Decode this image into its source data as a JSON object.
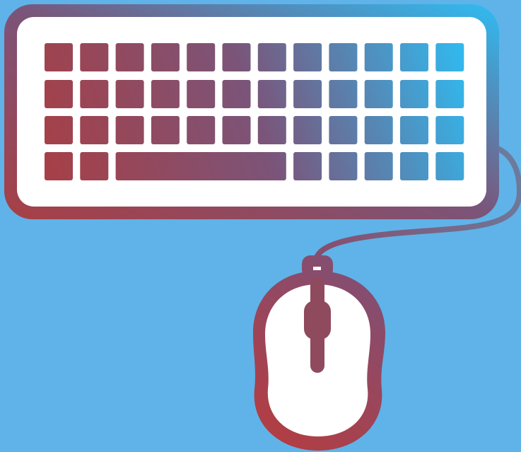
{
  "illustration": {
    "subject": [
      "keyboard-icon",
      "mouse-icon",
      "cable-icon"
    ],
    "colors": {
      "background": "#5fb3e8",
      "gradient_start": "#a83f45",
      "gradient_mid": "#7b5479",
      "gradient_end": "#2fbcf2",
      "key_face": "#ffffff"
    },
    "keyboard": {
      "rows": [
        12,
        12,
        12,
        12
      ],
      "bottom_row": [
        "key",
        "key",
        "spacebar",
        "key",
        "key",
        "key",
        "key",
        "key"
      ]
    }
  }
}
